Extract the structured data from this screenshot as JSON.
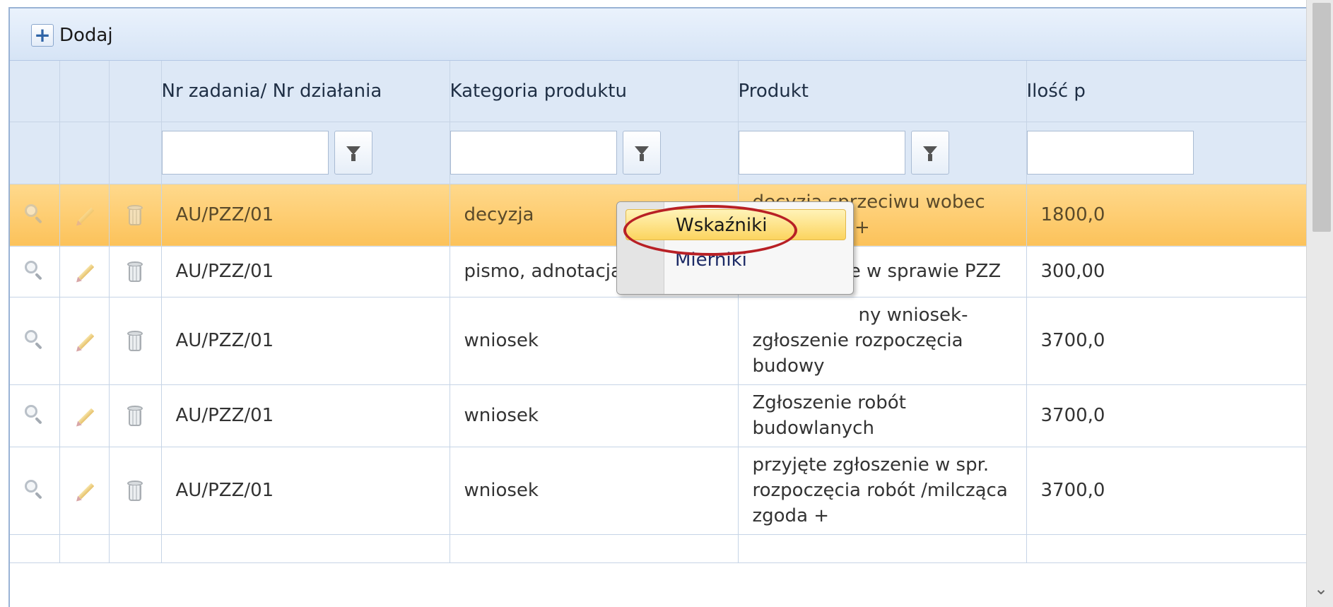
{
  "toolbar": {
    "add_label": "Dodaj",
    "add_icon": "plus-icon",
    "export_icon": "export-icon"
  },
  "columns": {
    "task_number": "Nr zadania/ Nr działania",
    "product_category": "Kategoria produktu",
    "product": "Produkt",
    "quantity": "Ilość p"
  },
  "filters": {
    "task_number": "",
    "product_category": "",
    "product": "",
    "quantity": ""
  },
  "rows": [
    {
      "task": "AU/PZZ/01",
      "category": "decyzja",
      "product": "decyzja sprzeciwu wobec zgłoszenia +",
      "quantity": "1800,0",
      "selected": true
    },
    {
      "task": "AU/PZZ/01",
      "category": "pismo, adnotacja",
      "product": "…ie w sprawie PZZ",
      "quantity": "300,00",
      "selected": false
    },
    {
      "task": "AU/PZZ/01",
      "category": "wniosek",
      "product": "…ny wniosek- zgłoszenie rozpoczęcia budowy",
      "quantity": "3700,0",
      "selected": false
    },
    {
      "task": "AU/PZZ/01",
      "category": "wniosek",
      "product": "Zgłoszenie robót budowlanych",
      "quantity": "3700,0",
      "selected": false
    },
    {
      "task": "AU/PZZ/01",
      "category": "wniosek",
      "product": "przyjęte zgłoszenie w spr. rozpoczęcia robót /milcząca zgoda +",
      "quantity": "3700,0",
      "selected": false
    }
  ],
  "row_products_display": {
    "r0": [
      "decyzja sprzeciwu wobec",
      "zgłoszenia +"
    ],
    "r1": [
      "ie w sprawie PZZ"
    ],
    "r2": [
      "ny wniosek-",
      "zgłoszenie rozpoczęcia",
      "budowy"
    ],
    "r3": [
      "Zgłoszenie robót",
      "budowlanych"
    ],
    "r4": [
      "przyjęte zgłoszenie w spr.",
      "rozpoczęcia robót /milcząca",
      "zgoda +"
    ]
  },
  "context_menu": {
    "items": [
      {
        "label": "Wskaźniki",
        "highlighted": true
      },
      {
        "label": "Mierniki",
        "highlighted": false
      }
    ],
    "annotation_color": "#b82025"
  },
  "colors": {
    "header_bg": "#dde8f6",
    "selected_row": "#fcc25a",
    "menu_highlight": "#fcd45f"
  }
}
